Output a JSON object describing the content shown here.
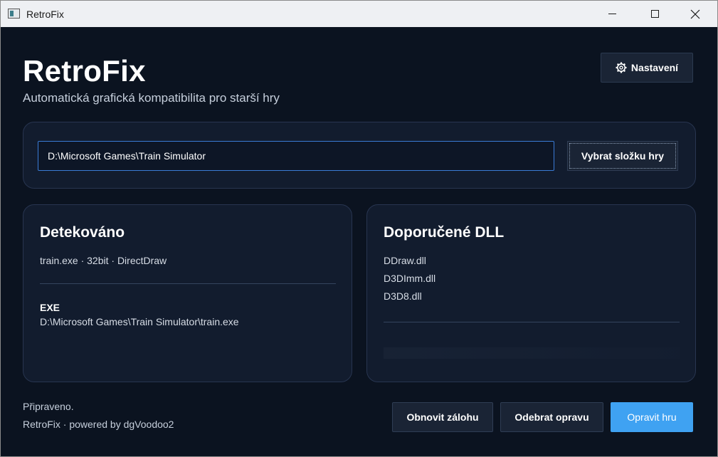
{
  "window": {
    "title": "RetroFix"
  },
  "header": {
    "title": "RetroFix",
    "subtitle": "Automatická grafická kompatibilita pro starší hry",
    "settings_label": "Nastavení"
  },
  "path": {
    "value": "D:\\Microsoft Games\\Train Simulator",
    "browse_label": "Vybrat složku hry"
  },
  "detected": {
    "title": "Detekováno",
    "info": "train.exe · 32bit · DirectDraw",
    "exe_label": "EXE",
    "exe_path": "D:\\Microsoft Games\\Train Simulator\\train.exe"
  },
  "dlls": {
    "title": "Doporučené DLL",
    "items": [
      "DDraw.dll",
      "D3DImm.dll",
      "D3D8.dll"
    ]
  },
  "status": {
    "text": "Připraveno.",
    "footer": "RetroFix · powered by dgVoodoo2"
  },
  "actions": {
    "restore_label": "Obnovit zálohu",
    "remove_label": "Odebrat opravu",
    "fix_label": "Opravit hru"
  },
  "icons": {
    "app": "app-window-icon",
    "settings": "gear-icon",
    "minimize": "minimize-icon",
    "maximize": "maximize-icon",
    "close": "close-icon"
  },
  "colors": {
    "background": "#0b1320",
    "card": "#121c2e",
    "accent": "#3fa2f2",
    "input_border": "#3a7bd5"
  }
}
